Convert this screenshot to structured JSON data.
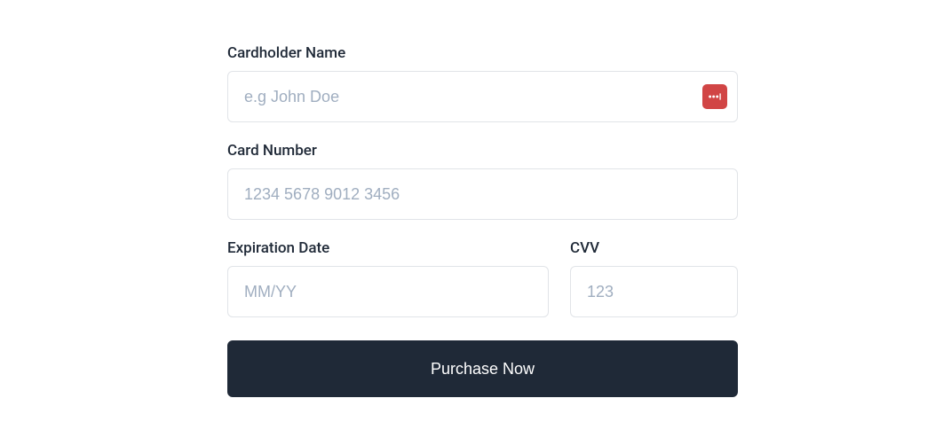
{
  "form": {
    "cardholder": {
      "label": "Cardholder Name",
      "placeholder": "e.g John Doe",
      "value": ""
    },
    "cardnumber": {
      "label": "Card Number",
      "placeholder": "1234 5678 9012 3456",
      "value": ""
    },
    "expiration": {
      "label": "Expiration Date",
      "placeholder": "MM/YY",
      "value": ""
    },
    "cvv": {
      "label": "CVV",
      "placeholder": "123",
      "value": ""
    },
    "submit": {
      "label": "Purchase Now"
    }
  },
  "icons": {
    "password_manager": "password-manager-icon"
  }
}
